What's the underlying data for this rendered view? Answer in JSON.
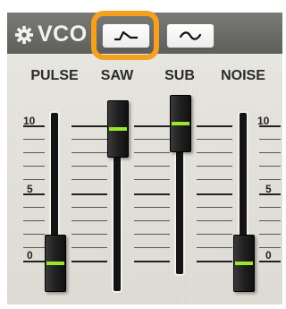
{
  "module": {
    "title": "VCO",
    "gear_icon": "gear-icon"
  },
  "waveforms": [
    {
      "icon": "saw-wave-icon",
      "selected": true
    },
    {
      "icon": "sine-wave-icon",
      "selected": false
    }
  ],
  "highlight_color": "#f5a01e",
  "indicator_color": "#9be82a",
  "sliders": [
    {
      "label": "PULSE",
      "level": 0.0
    },
    {
      "label": "SAW",
      "level": 1.0
    },
    {
      "label": "SUB",
      "level": 1.0
    },
    {
      "label": "NOISE",
      "level": 0.0
    }
  ],
  "scale": {
    "top": "10",
    "mid": "5",
    "bottom": "0"
  }
}
